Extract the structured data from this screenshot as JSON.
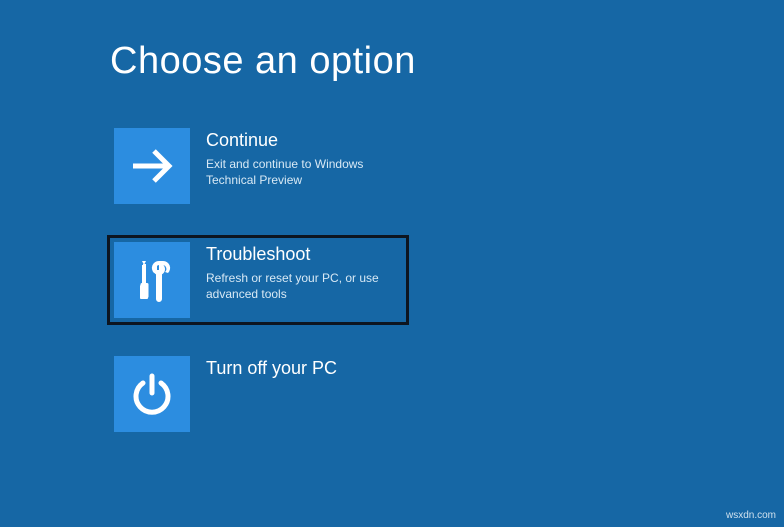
{
  "page_title": "Choose an option",
  "options": [
    {
      "icon": "arrow-right-icon",
      "title": "Continue",
      "desc": "Exit and continue to Windows Technical Preview"
    },
    {
      "icon": "tools-icon",
      "title": "Troubleshoot",
      "desc": "Refresh or reset your PC, or use advanced tools",
      "highlighted": true
    },
    {
      "icon": "power-icon",
      "title": "Turn off your PC",
      "desc": ""
    }
  ],
  "watermark": "wsxdn.com"
}
